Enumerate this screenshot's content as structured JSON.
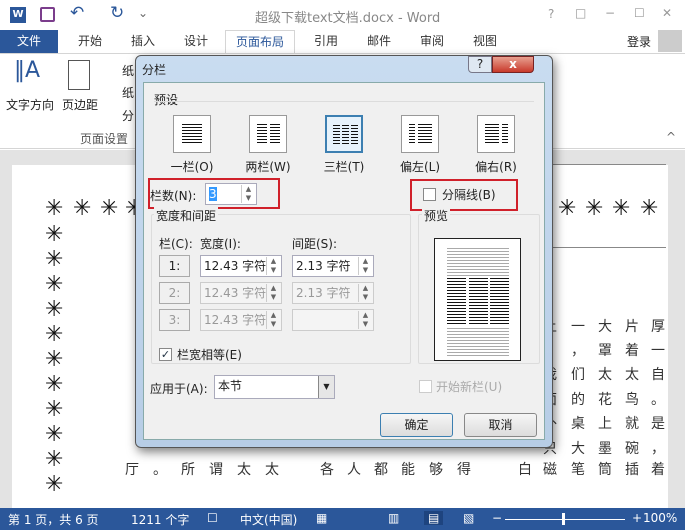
{
  "window": {
    "title": "超级下载text文档.docx - Word",
    "help": "?",
    "restore": "□",
    "minimize": "−",
    "maximize": "☐",
    "close": "✕"
  },
  "quick_access": {
    "undo": "↶",
    "redo": "↻",
    "customize": "⌄"
  },
  "tabs": [
    "文件",
    "开始",
    "插入",
    "设计",
    "页面布局",
    "引用",
    "邮件",
    "审阅",
    "视图"
  ],
  "active_tab": "页面布局",
  "signin": "登录",
  "ribbon": {
    "text_direction": "文字方向",
    "margins": "页边距",
    "item1": "纸",
    "item2": "纸",
    "item3": "分",
    "group": "页面设置"
  },
  "dialog": {
    "title": "分栏",
    "help": "?",
    "close": "x",
    "presets_label": "预设",
    "presets": [
      "一栏(O)",
      "两栏(W)",
      "三栏(T)",
      "偏左(L)",
      "偏右(R)"
    ],
    "selected_preset": "三栏(T)",
    "num_cols_label": "栏数(N):",
    "num_cols": "3",
    "line_between_label": "分隔线(B)",
    "line_between": false,
    "width_spacing_label": "宽度和间距",
    "col_header": "栏(C):",
    "width_header": "宽度(I):",
    "spacing_header": "间距(S):",
    "rows": [
      {
        "col": "1:",
        "width": "12.43 字符",
        "spacing": "2.13 字符"
      },
      {
        "col": "2:",
        "width": "12.43 字符",
        "spacing": "2.13 字符"
      },
      {
        "col": "3:",
        "width": "12.43 字符",
        "spacing": ""
      }
    ],
    "equal_width_label": "栏宽相等(E)",
    "equal_width": true,
    "preview_label": "预览",
    "apply_label": "应用于(A):",
    "apply_value": "本节",
    "new_col_label": "开始新栏(U)",
    "ok": "确定",
    "cancel": "取消",
    "highlight_color": "#d0202a"
  },
  "document": {
    "star": "✳",
    "right_rows": [
      [
        "上",
        "一",
        "大",
        "片",
        "厚"
      ],
      [
        "，",
        "罩",
        "着",
        "一"
      ],
      [
        "我",
        "们",
        "太",
        "太",
        "自"
      ],
      [
        "面",
        "的",
        "花",
        "鸟",
        "。"
      ],
      [
        "外",
        "桌",
        "上",
        "就",
        "是"
      ],
      [
        "只",
        "大",
        "墨",
        "碗",
        "，"
      ]
    ],
    "bottom_rows": [
      [
        "厅",
        "。",
        "所",
        "谓",
        "太",
        "太"
      ],
      [
        "各",
        "人",
        "都",
        "能",
        "够",
        "得"
      ],
      [
        "白",
        "磁",
        "笔",
        "筒",
        "插",
        "着"
      ]
    ]
  },
  "status": {
    "page": "第 1 页，共 6 页",
    "words": "1211 个字",
    "language": "中文(中国)",
    "zoom": "100%",
    "zoom_level": 100
  },
  "colors": {
    "accent": "#2b579a"
  }
}
